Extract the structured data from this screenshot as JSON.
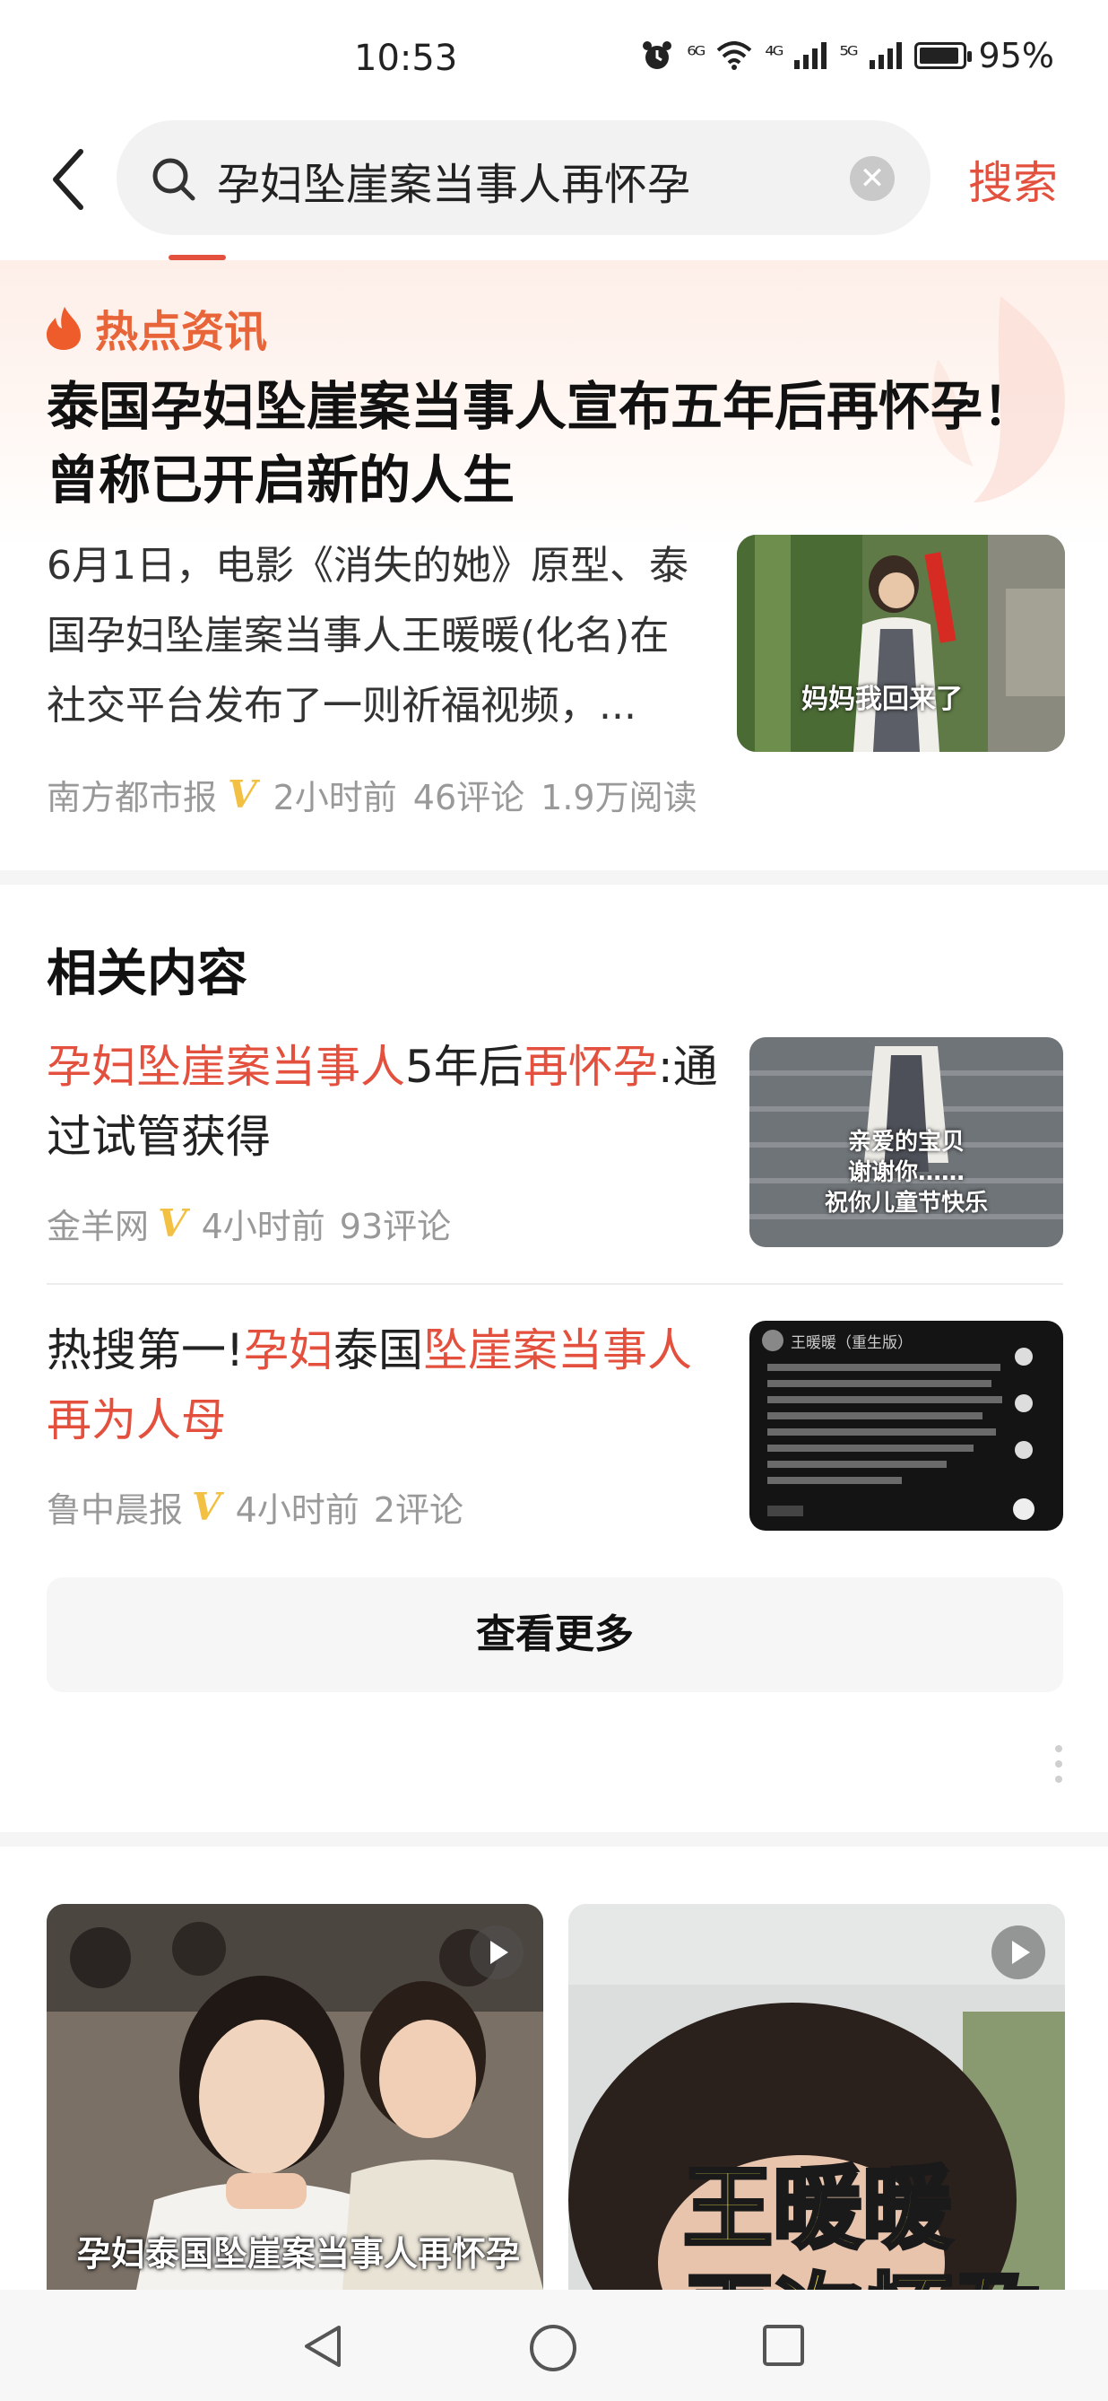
{
  "status_bar": {
    "time": "10:53",
    "signal_1": "⁶ᴳ",
    "signal_2": "⁴ᴳ",
    "signal_3": "⁵ᴳ",
    "battery_percent": "95%",
    "battery_level": 0.95,
    "icons": [
      "alarm-icon",
      "wifi-icon",
      "cell-signal-icon",
      "cell-signal-icon",
      "battery-icon"
    ]
  },
  "search": {
    "query": "孕妇坠崖案当事人再怀孕",
    "submit_label": "搜索",
    "accent": "#e4503e"
  },
  "hot_news": {
    "label": "热点资讯",
    "title": "泰国孕妇坠崖案当事人宣布五年后再怀孕！曾称已开启新的人生",
    "summary": "6月1日，电影《消失的她》原型、泰国孕妇坠崖案当事人王暖暖(化名)在社交平台发布了一则祈福视频，...",
    "thumb_caption": "妈妈我回来了",
    "source": "南方都市报",
    "time": "2小时前",
    "comments": "46评论",
    "reads": "1.9万阅读"
  },
  "related": {
    "heading": "相关内容",
    "items": [
      {
        "title_parts": [
          "孕妇坠崖案当事人",
          "5年后",
          "再怀孕",
          ":通过试管获得"
        ],
        "source": "金羊网",
        "time": "4小时前",
        "comments": "93评论",
        "thumb_caption": [
          "亲爱的宝贝",
          "谢谢你……",
          "祝你儿童节快乐"
        ]
      },
      {
        "title_parts": [
          "热搜第一!",
          "孕妇",
          "泰国",
          "坠崖案当事人",
          "再为人母"
        ],
        "source": "鲁中晨报",
        "time": "4小时前",
        "comments": "2评论",
        "thumb_header": "王暖暖（重生版）"
      }
    ],
    "more_label": "查看更多"
  },
  "videos": [
    {
      "caption": "孕妇泰国坠崖案当事人再怀孕"
    },
    {
      "overlay_line1": "王暖暖",
      "overlay_line2": "再次怀孕"
    }
  ],
  "nav": [
    "back-nav-icon",
    "home-nav-icon",
    "recents-nav-icon"
  ]
}
